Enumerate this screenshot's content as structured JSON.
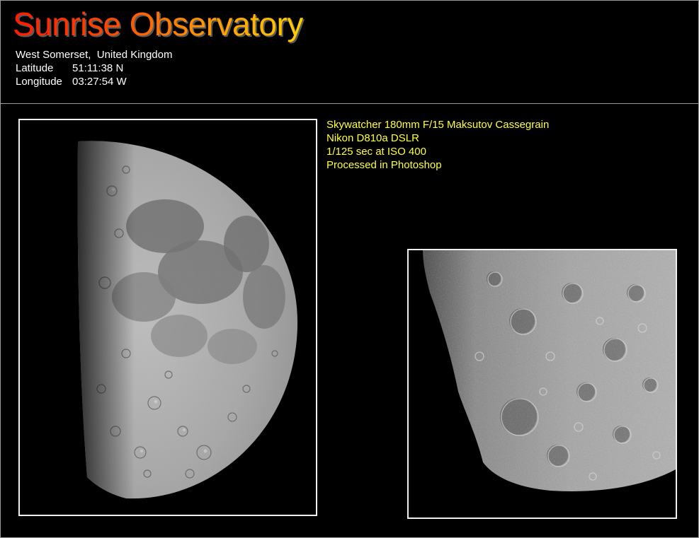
{
  "header": {
    "title": "Sunrise Observatory",
    "location": "West Somerset,  United Kingdom",
    "latitude_label": "Latitude",
    "latitude_value": "51:11:38 N",
    "longitude_label": "Longitude",
    "longitude_value": "03:27:54 W"
  },
  "equipment": {
    "telescope": "Skywatcher 180mm F/15 Maksutov Cassegrain",
    "camera": "Nikon D810a DSLR",
    "exposure": "1/125 sec at ISO 400",
    "processing": "Processed in Photoshop"
  },
  "images": {
    "main": "moon-first-quarter-photo",
    "detail": "lunar-crater-closeup-photo"
  },
  "colors": {
    "background": "#000000",
    "equipment_text": "#ffff3c",
    "body_text": "#ffffff",
    "frame": "#f0f0f0"
  }
}
